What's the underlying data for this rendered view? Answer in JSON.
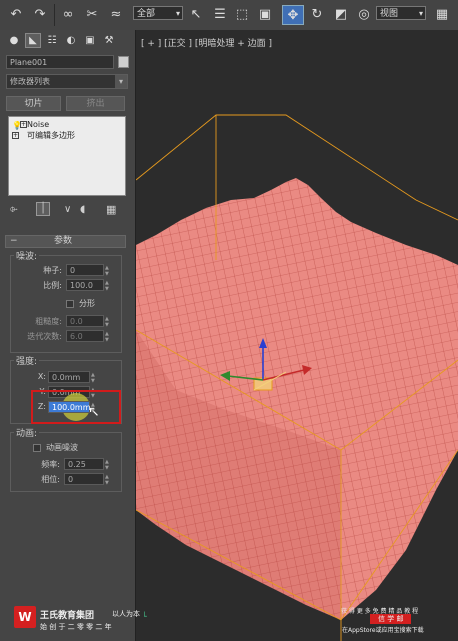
{
  "toolbar": {
    "undo_icon": "undo-arrow",
    "redo_icon": "redo-arrow",
    "selection_filter": "全部",
    "ref_coord": "视图"
  },
  "panel": {
    "tabs": [
      "create-icon",
      "modify-icon",
      "hierarchy-icon",
      "motion-icon",
      "display-icon",
      "utilities-icon"
    ],
    "object_name": "Plane001",
    "modifier_list": "修改器列表",
    "btn_slice": "切片",
    "btn_extrude": "挤出",
    "stack": [
      {
        "label": "Noise",
        "expander": "+"
      },
      {
        "label": "可编辑多边形",
        "expander": "+"
      }
    ],
    "rollout_title": "参数",
    "noise": {
      "title": "噪波:",
      "seed_label": "种子:",
      "seed_value": "0",
      "scale_label": "比例:",
      "scale_value": "100.0",
      "fractal_label": "分形",
      "roughness_label": "粗糙度:",
      "roughness_value": "0.0",
      "iterations_label": "迭代次数:",
      "iterations_value": "6.0"
    },
    "strength": {
      "title": "强度:",
      "x_label": "X:",
      "x_value": "0.0mm",
      "y_label": "Y:",
      "y_value": "0.0mm",
      "z_label": "Z:",
      "z_value": "100.0mm"
    },
    "animation": {
      "title": "动画:",
      "animate_label": "动画噪波",
      "freq_label": "频率:",
      "freq_value": "0.25",
      "phase_label": "相位:",
      "phase_value": "0"
    }
  },
  "viewport": {
    "label": "[ + ] [正交 ] [明暗处理 + 边面 ]",
    "mesh_color": "#e9837c",
    "wire_color": "#c04a44",
    "bbox_color": "#e69a1e"
  },
  "watermark": {
    "logo_char": "W",
    "company": "王氏教育集团",
    "slogan": "以人为本",
    "sub": "始 创 于 二 零 零 二 年",
    "right_top": "获 得 更 多 免 费 精 品 教 程",
    "right_mid": "信 学 邮",
    "right_bot": "在AppStore或应用宝搜索下载"
  }
}
